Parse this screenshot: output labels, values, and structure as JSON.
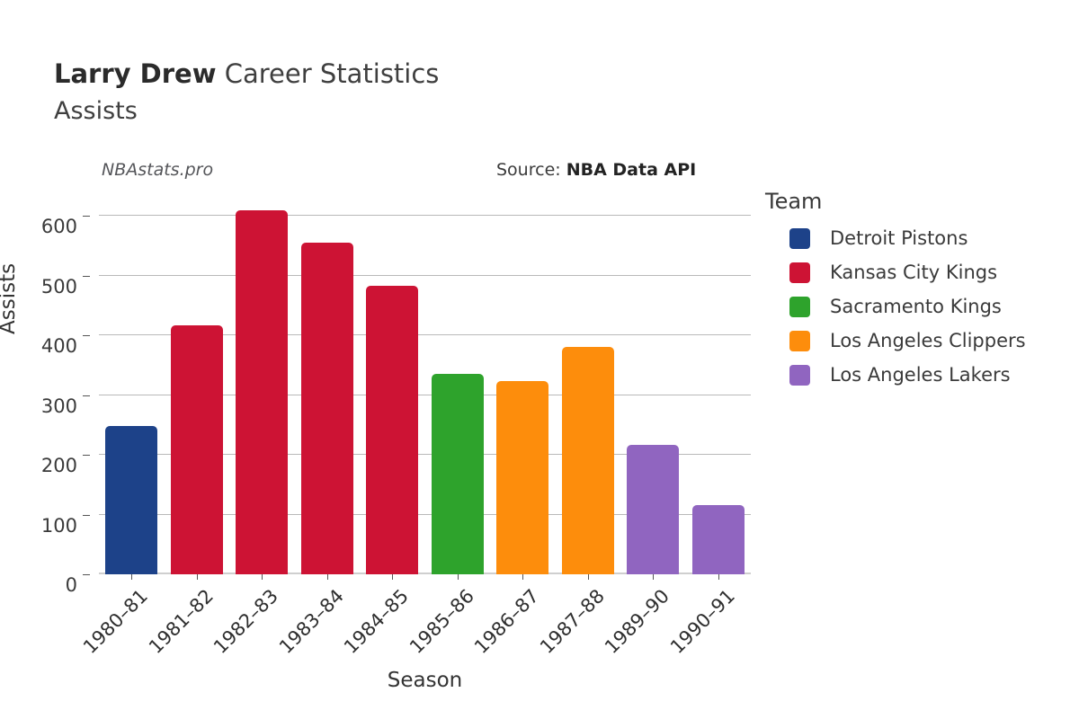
{
  "header": {
    "player_name": "Larry Drew",
    "title_suffix": " Career Statistics",
    "subtitle": "Assists"
  },
  "annotations": {
    "watermark": "NBAstats.pro",
    "source_prefix": "Source: ",
    "source_value": "NBA Data API"
  },
  "legend": {
    "title": "Team",
    "items": [
      {
        "label": "Detroit Pistons",
        "color": "#1d4289"
      },
      {
        "label": "Kansas City Kings",
        "color": "#cd1334"
      },
      {
        "label": "Sacramento Kings",
        "color": "#2ea32c"
      },
      {
        "label": "Los Angeles Clippers",
        "color": "#fd8d0c"
      },
      {
        "label": "Los Angeles Lakers",
        "color": "#9065c0"
      }
    ]
  },
  "chart_data": {
    "type": "bar",
    "title": "Larry Drew Career Statistics",
    "subtitle": "Assists",
    "xlabel": "Season",
    "ylabel": "Assists",
    "ylim": [
      0,
      620
    ],
    "yticks": [
      0,
      100,
      200,
      300,
      400,
      500,
      600
    ],
    "grid": true,
    "legend_position": "right",
    "categories": [
      "1980–81",
      "1981–82",
      "1982–83",
      "1983–84",
      "1984–85",
      "1985–86",
      "1986–87",
      "1987–88",
      "1989–90",
      "1990–91"
    ],
    "values": [
      248,
      417,
      609,
      556,
      483,
      336,
      323,
      380,
      216,
      116
    ],
    "bar_teams": [
      "Detroit Pistons",
      "Kansas City Kings",
      "Kansas City Kings",
      "Kansas City Kings",
      "Kansas City Kings",
      "Sacramento Kings",
      "Los Angeles Clippers",
      "Los Angeles Clippers",
      "Los Angeles Lakers",
      "Los Angeles Lakers"
    ],
    "bar_colors": [
      "#1d4289",
      "#cd1334",
      "#cd1334",
      "#cd1334",
      "#cd1334",
      "#2ea32c",
      "#fd8d0c",
      "#fd8d0c",
      "#9065c0",
      "#9065c0"
    ]
  }
}
